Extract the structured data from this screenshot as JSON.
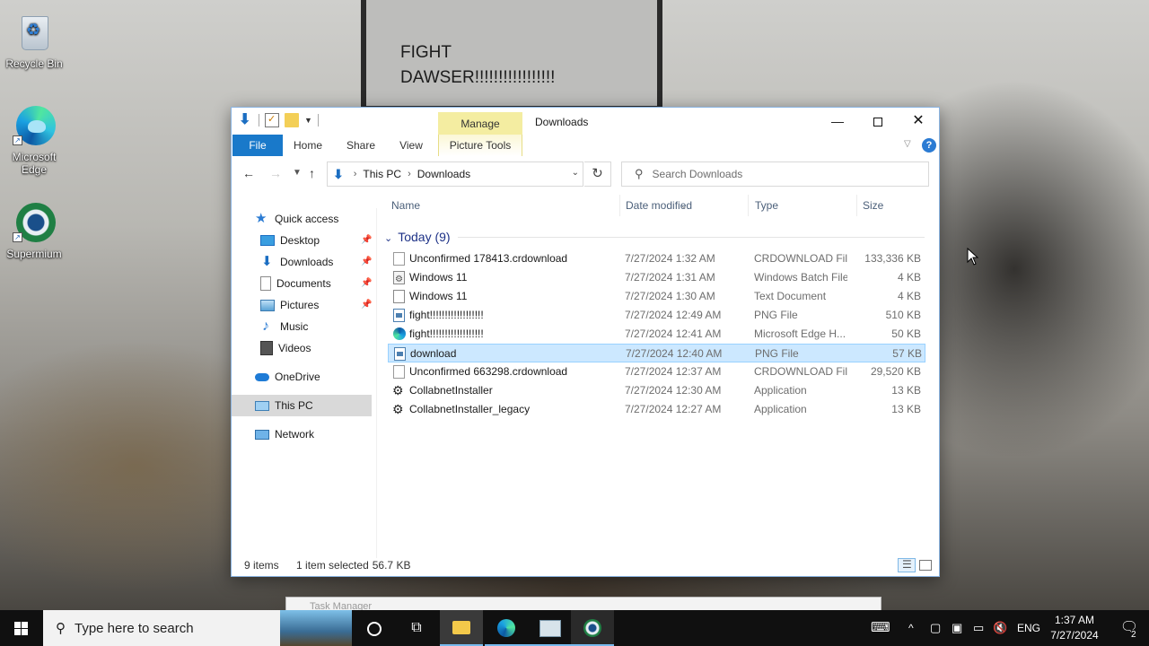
{
  "desktop": {
    "icons": [
      {
        "label": "Recycle Bin"
      },
      {
        "label": "Microsoft Edge"
      },
      {
        "label": "Supermium"
      }
    ],
    "sign": {
      "line1": "FIGHT",
      "line2": "DAWSER!!!!!!!!!!!!!!!!!"
    }
  },
  "window": {
    "title": "Downloads",
    "contextual_tab": "Manage",
    "ribbon_tabs": {
      "file": "File",
      "home": "Home",
      "share": "Share",
      "view": "View",
      "picture_tools": "Picture Tools"
    },
    "address": {
      "crumbs": [
        "This PC",
        "Downloads"
      ]
    },
    "search": {
      "placeholder": "Search Downloads"
    },
    "nav": {
      "quick_access": "Quick access",
      "items": [
        {
          "label": "Desktop",
          "pinned": true
        },
        {
          "label": "Downloads",
          "pinned": true
        },
        {
          "label": "Documents",
          "pinned": true
        },
        {
          "label": "Pictures",
          "pinned": true
        },
        {
          "label": "Music",
          "pinned": false
        },
        {
          "label": "Videos",
          "pinned": false
        }
      ],
      "onedrive": "OneDrive",
      "this_pc": "This PC",
      "network": "Network"
    },
    "columns": {
      "name": "Name",
      "date": "Date modified",
      "type": "Type",
      "size": "Size"
    },
    "group": "Today (9)",
    "files": [
      {
        "name": "Unconfirmed 178413.crdownload",
        "date": "7/27/2024 1:32 AM",
        "type": "CRDOWNLOAD File",
        "size": "133,336 KB",
        "icon": "blank-file-icon"
      },
      {
        "name": "Windows 11",
        "date": "7/27/2024 1:31 AM",
        "type": "Windows Batch File",
        "size": "4 KB",
        "icon": "batch-file-icon"
      },
      {
        "name": "Windows 11",
        "date": "7/27/2024 1:30 AM",
        "type": "Text Document",
        "size": "4 KB",
        "icon": "text-file-icon"
      },
      {
        "name": "fight!!!!!!!!!!!!!!!!!!",
        "date": "7/27/2024 12:49 AM",
        "type": "PNG File",
        "size": "510 KB",
        "icon": "png-file-icon"
      },
      {
        "name": "fight!!!!!!!!!!!!!!!!!!",
        "date": "7/27/2024 12:41 AM",
        "type": "Microsoft Edge H...",
        "size": "50 KB",
        "icon": "edge-file-icon"
      },
      {
        "name": "download",
        "date": "7/27/2024 12:40 AM",
        "type": "PNG File",
        "size": "57 KB",
        "icon": "png-file-icon"
      },
      {
        "name": "Unconfirmed 663298.crdownload",
        "date": "7/27/2024 12:37 AM",
        "type": "CRDOWNLOAD File",
        "size": "29,520 KB",
        "icon": "blank-file-icon"
      },
      {
        "name": "CollabnetInstaller",
        "date": "7/27/2024 12:30 AM",
        "type": "Application",
        "size": "13 KB",
        "icon": "application-icon"
      },
      {
        "name": "CollabnetInstaller_legacy",
        "date": "7/27/2024 12:27 AM",
        "type": "Application",
        "size": "13 KB",
        "icon": "application-icon"
      }
    ],
    "selected_index": 5,
    "status": {
      "count": "9 items",
      "selection": "1 item selected",
      "size": "56.7 KB"
    }
  },
  "task_manager_peek": "Task Manager",
  "taskbar": {
    "search_placeholder": "Type here to search",
    "language": "ENG",
    "time": "1:37 AM",
    "date": "7/27/2024",
    "notification_count": "2"
  }
}
